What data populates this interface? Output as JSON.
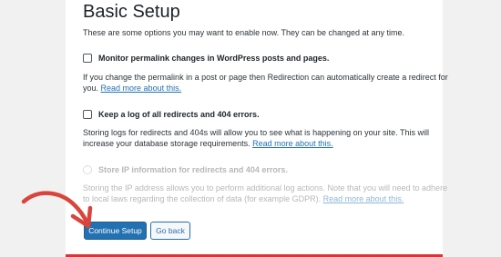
{
  "page": {
    "title": "Basic Setup",
    "intro": "These are some options you may want to enable now. They can be changed at any time."
  },
  "options": [
    {
      "label": "Monitor permalink changes in WordPress posts and pages.",
      "description_lines": [
        "If you change the permalink in a post or page then Redirection can automatically create a redirect for",
        "you."
      ],
      "link": "Read more about this.",
      "checked": false,
      "disabled": false
    },
    {
      "label": "Keep a log of all redirects and 404 errors.",
      "description_lines": [
        "Storing logs for redirects and 404s will allow you to see what is happening on your site. This will",
        "increase your database storage requirements."
      ],
      "link": "Read more about this.",
      "checked": false,
      "disabled": false
    },
    {
      "label": "Store IP information for redirects and 404 errors.",
      "description_lines": [
        "Storing the IP address allows you to perform additional log actions. Note that you will need to adhere",
        "to local laws regarding the collection of data (for example GDPR)."
      ],
      "link": "Read more about this.",
      "checked": false,
      "disabled": true
    }
  ],
  "buttons": {
    "continue": "Continue Setup",
    "back": "Go back"
  },
  "colors": {
    "primary": "#2271b1",
    "accent": "#d63638",
    "annotation_arrow": "#d9453c"
  }
}
